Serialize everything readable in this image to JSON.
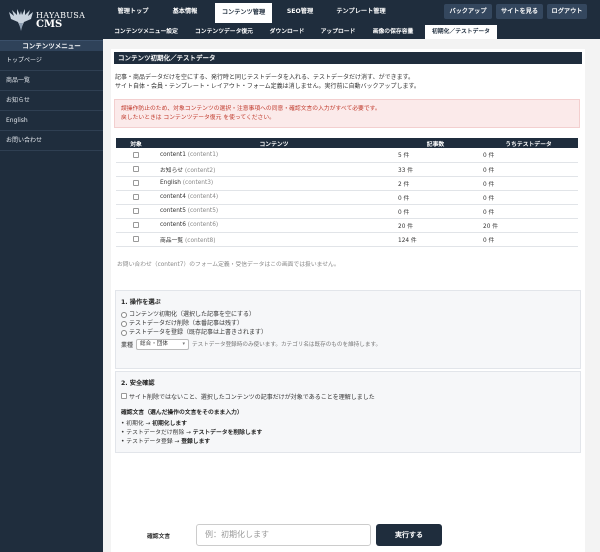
{
  "brand": {
    "line1": "HAYABUSA",
    "line2": "CMS"
  },
  "sidebar": {
    "heading": "コンテンツメニュー",
    "items": [
      {
        "label": "トップページ"
      },
      {
        "label": "商品一覧"
      },
      {
        "label": "お知らせ"
      },
      {
        "label": "English"
      },
      {
        "label": "お問い合わせ"
      }
    ]
  },
  "topnav": {
    "items": [
      {
        "label": "管理トップ"
      },
      {
        "label": "基本情報"
      },
      {
        "label": "コンテンツ管理",
        "active": true
      },
      {
        "label": "SEO管理"
      },
      {
        "label": "テンプレート管理"
      }
    ],
    "right": [
      {
        "label": "バックアップ"
      },
      {
        "label": "サイトを見る"
      },
      {
        "label": "ログアウト"
      }
    ]
  },
  "subnav": {
    "items": [
      {
        "label": "コンテンツメニュー設定"
      },
      {
        "label": "コンテンツデータ復元"
      },
      {
        "label": "ダウンロード"
      },
      {
        "label": "アップロード"
      },
      {
        "label": "画像の保存容量"
      },
      {
        "label": "初期化／テストデータ",
        "active": true
      }
    ]
  },
  "panel": {
    "title": "コンテンツ初期化／テストデータ",
    "desc1": "記事・商品データだけを空にする、発行時と同じテストデータを入れる、テストデータだけ消す、ができます。",
    "desc2": "サイト自体・会員・テンプレート・レイアウト・フォーム定義は消しません。実行前に自動バックアップします。",
    "warn1": "誤操作防止のため、対象コンテンツの選択・注意事項への同意・確認文言の入力がすべて必要です。",
    "warn2": "戻したいときは コンテンツデータ復元 を使ってください。"
  },
  "table": {
    "headers": {
      "target": "対象",
      "content": "コンテンツ",
      "count": "記事数",
      "test": "うちテストデータ"
    },
    "rows": [
      {
        "name": "content1",
        "key": "(content1)",
        "count": "5 件",
        "test": "0 件"
      },
      {
        "name": "お知らせ",
        "key": "(content2)",
        "count": "33 件",
        "test": "0 件"
      },
      {
        "name": "English",
        "key": "(content3)",
        "count": "2 件",
        "test": "0 件"
      },
      {
        "name": "content4",
        "key": "(content4)",
        "count": "0 件",
        "test": "0 件"
      },
      {
        "name": "content5",
        "key": "(content5)",
        "count": "0 件",
        "test": "0 件"
      },
      {
        "name": "content6",
        "key": "(content6)",
        "count": "20 件",
        "test": "20 件"
      },
      {
        "name": "商品一覧",
        "key": "(content8)",
        "count": "124 件",
        "test": "0 件"
      }
    ],
    "note": "お問い合わせ（content7）のフォーム定義・受信データはこの画面では扱いません。"
  },
  "step1": {
    "heading": "1. 操作を選ぶ",
    "options": [
      {
        "label": "コンテンツ初期化（選択した記事を空にする）"
      },
      {
        "label": "テストデータだけ削除（本番記事は残す）"
      },
      {
        "label": "テストデータを登録（既存記事は上書きされます）"
      }
    ],
    "industry_label": "業種",
    "industry_value": "総合・団体",
    "industry_note": "テストデータ登録時のみ使います。カテゴリ名は既存のものを維持します。"
  },
  "step2": {
    "heading": "2. 安全確認",
    "agree": "サイト削除ではないこと、選択したコンテンツの記事だけが対象であることを理解しました",
    "phrase_heading": "確認文言（選んだ操作の文言をそのまま入力）",
    "phrases": [
      {
        "prefix": "初期化 →",
        "phrase": "初期化します"
      },
      {
        "prefix": "テストデータだけ削除 →",
        "phrase": "テストデータを削除します"
      },
      {
        "prefix": "テストデータ登録 →",
        "phrase": "登録します"
      }
    ]
  },
  "footer": {
    "label": "確認文言",
    "placeholder": "例：初期化します",
    "button": "実行する"
  },
  "colors": {
    "navy": "#1f2d3d",
    "warn": "#c0392b"
  }
}
